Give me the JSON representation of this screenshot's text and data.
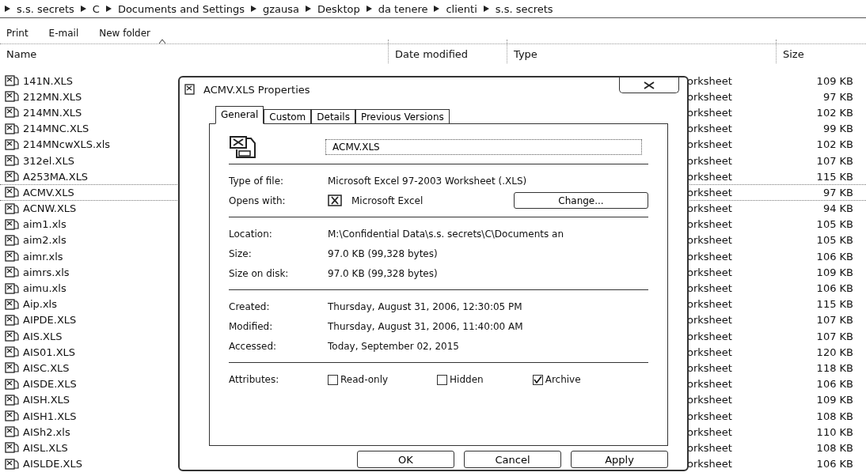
{
  "breadcrumb": [
    "s.s. secrets",
    "C",
    "Documents and Settings",
    "gzausa",
    "Desktop",
    "da tenere",
    "clienti",
    "s.s. secrets"
  ],
  "toolbar": [
    "Print",
    "E-mail",
    "New folder"
  ],
  "columns": [
    {
      "label": "Name",
      "sorted": true
    },
    {
      "label": "Date modified",
      "sorted": false
    },
    {
      "label": "Type",
      "sorted": false
    },
    {
      "label": "Size",
      "sorted": false
    }
  ],
  "files": [
    {
      "name": "141N.XLS",
      "type": "orksheet",
      "size": "109 KB",
      "selected": false
    },
    {
      "name": "212MN.XLS",
      "type": "orksheet",
      "size": "97 KB",
      "selected": false
    },
    {
      "name": "214MN.XLS",
      "type": "orksheet",
      "size": "102 KB",
      "selected": false
    },
    {
      "name": "214MNC.XLS",
      "type": "orksheet",
      "size": "99 KB",
      "selected": false
    },
    {
      "name": "214MNcwXLS.xls",
      "type": "orksheet",
      "size": "102 KB",
      "selected": false
    },
    {
      "name": "312el.XLS",
      "type": "orksheet",
      "size": "107 KB",
      "selected": false
    },
    {
      "name": "A253MA.XLS",
      "type": "orksheet",
      "size": "115 KB",
      "selected": false
    },
    {
      "name": "ACMV.XLS",
      "type": "orksheet",
      "size": "97 KB",
      "selected": true
    },
    {
      "name": "ACNW.XLS",
      "type": "orksheet",
      "size": "94 KB",
      "selected": false
    },
    {
      "name": "aim1.xls",
      "type": "orksheet",
      "size": "105 KB",
      "selected": false
    },
    {
      "name": "aim2.xls",
      "type": "orksheet",
      "size": "105 KB",
      "selected": false
    },
    {
      "name": "aimr.xls",
      "type": "orksheet",
      "size": "106 KB",
      "selected": false
    },
    {
      "name": "aimrs.xls",
      "type": "orksheet",
      "size": "109 KB",
      "selected": false
    },
    {
      "name": "aimu.xls",
      "type": "orksheet",
      "size": "106 KB",
      "selected": false
    },
    {
      "name": "Aip.xls",
      "type": "orksheet",
      "size": "115 KB",
      "selected": false
    },
    {
      "name": "AIPDE.XLS",
      "type": "orksheet",
      "size": "107 KB",
      "selected": false
    },
    {
      "name": "AIS.XLS",
      "type": "orksheet",
      "size": "107 KB",
      "selected": false
    },
    {
      "name": "AIS01.XLS",
      "type": "orksheet",
      "size": "120 KB",
      "selected": false
    },
    {
      "name": "AISC.XLS",
      "type": "orksheet",
      "size": "118 KB",
      "selected": false
    },
    {
      "name": "AISDE.XLS",
      "type": "orksheet",
      "size": "106 KB",
      "selected": false
    },
    {
      "name": "AISH.XLS",
      "type": "orksheet",
      "size": "109 KB",
      "selected": false
    },
    {
      "name": "AISH1.XLS",
      "type": "orksheet",
      "size": "108 KB",
      "selected": false
    },
    {
      "name": "AISh2.xls",
      "type": "orksheet",
      "size": "110 KB",
      "selected": false
    },
    {
      "name": "AISL.XLS",
      "type": "orksheet",
      "size": "108 KB",
      "selected": false
    },
    {
      "name": "AISLDE.XLS",
      "type": "orksheet",
      "size": "106 KB",
      "selected": false
    }
  ],
  "dialog": {
    "title": "ACMV.XLS Properties",
    "tabs": [
      {
        "label": "General",
        "selected": true
      },
      {
        "label": "Custom",
        "selected": false
      },
      {
        "label": "Details",
        "selected": false
      },
      {
        "label": "Previous Versions",
        "selected": false
      }
    ],
    "filename": "ACMV.XLS",
    "groups": [
      [
        {
          "label": "Type of file:",
          "value": "Microsoft Excel 97-2003 Worksheet (.XLS)",
          "kind": "text"
        },
        {
          "label": "Opens with:",
          "value": "Microsoft Excel",
          "kind": "app",
          "button": "Change..."
        }
      ],
      [
        {
          "label": "Location:",
          "value": "M:\\Confidential Data\\s.s. secrets\\C\\Documents an",
          "kind": "text"
        },
        {
          "label": "Size:",
          "value": "97.0 KB (99,328 bytes)",
          "kind": "text"
        },
        {
          "label": "Size on disk:",
          "value": "97.0 KB (99,328 bytes)",
          "kind": "text"
        }
      ],
      [
        {
          "label": "Created:",
          "value": "Thursday, August 31, 2006, 12:30:05 PM",
          "kind": "text"
        },
        {
          "label": "Modified:",
          "value": "Thursday, August 31, 2006, 11:40:00 AM",
          "kind": "text"
        },
        {
          "label": "Accessed:",
          "value": "Today, September 02, 2015",
          "kind": "text"
        }
      ]
    ],
    "attributes_label": "Attributes:",
    "attributes": [
      {
        "label": "Read-only",
        "checked": false
      },
      {
        "label": "Hidden",
        "checked": false
      },
      {
        "label": "Archive",
        "checked": true
      }
    ],
    "buttons": [
      "OK",
      "Cancel",
      "Apply"
    ]
  }
}
